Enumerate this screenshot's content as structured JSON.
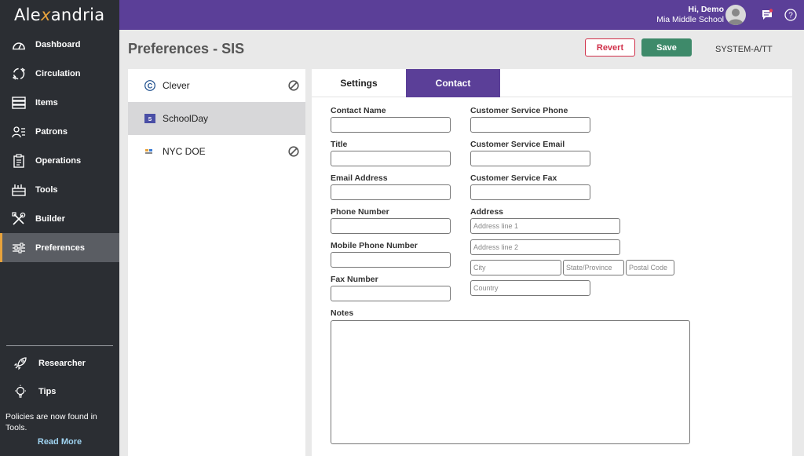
{
  "app": {
    "logo_pre": "Ale",
    "logo_x": "x",
    "logo_post": "andria"
  },
  "user": {
    "greeting": "Hi, Demo",
    "school": "Mia Middle School"
  },
  "sidebar": {
    "items": [
      {
        "label": "Dashboard",
        "icon": "gauge-icon"
      },
      {
        "label": "Circulation",
        "icon": "circulation-icon"
      },
      {
        "label": "Items",
        "icon": "stack-icon"
      },
      {
        "label": "Patrons",
        "icon": "users-icon"
      },
      {
        "label": "Operations",
        "icon": "clipboard-icon"
      },
      {
        "label": "Tools",
        "icon": "toolbox-icon"
      },
      {
        "label": "Builder",
        "icon": "tools-icon"
      },
      {
        "label": "Preferences",
        "icon": "sliders-icon",
        "active": true
      }
    ],
    "researcher": "Researcher",
    "tips": "Tips",
    "policy_note": "Policies are now found in Tools.",
    "read_more": "Read More"
  },
  "page": {
    "title": "Preferences - SIS",
    "revert": "Revert",
    "save": "Save",
    "site_code": "SYSTEM-A/TT"
  },
  "sources": [
    {
      "name": "Clever",
      "disabled": true
    },
    {
      "name": "SchoolDay",
      "selected": true
    },
    {
      "name": "NYC DOE",
      "disabled": true
    }
  ],
  "tabs": [
    {
      "label": "Settings",
      "active": false
    },
    {
      "label": "Contact",
      "active": true
    }
  ],
  "form": {
    "contact_name": "Contact Name",
    "title": "Title",
    "email": "Email Address",
    "phone": "Phone Number",
    "mobile": "Mobile Phone Number",
    "fax": "Fax Number",
    "cs_phone": "Customer Service Phone",
    "cs_email": "Customer Service Email",
    "cs_fax": "Customer Service Fax",
    "address": "Address",
    "address1_ph": "Address line 1",
    "address2_ph": "Address line 2",
    "city_ph": "City",
    "state_ph": "State/Province",
    "postal_ph": "Postal Code",
    "country_ph": "Country",
    "notes": "Notes"
  },
  "colors": {
    "accent": "#5b3f98",
    "sidebar": "#2b2e33",
    "save": "#3e8a6a",
    "revert": "#d0304a",
    "highlight": "#e8a33c"
  }
}
